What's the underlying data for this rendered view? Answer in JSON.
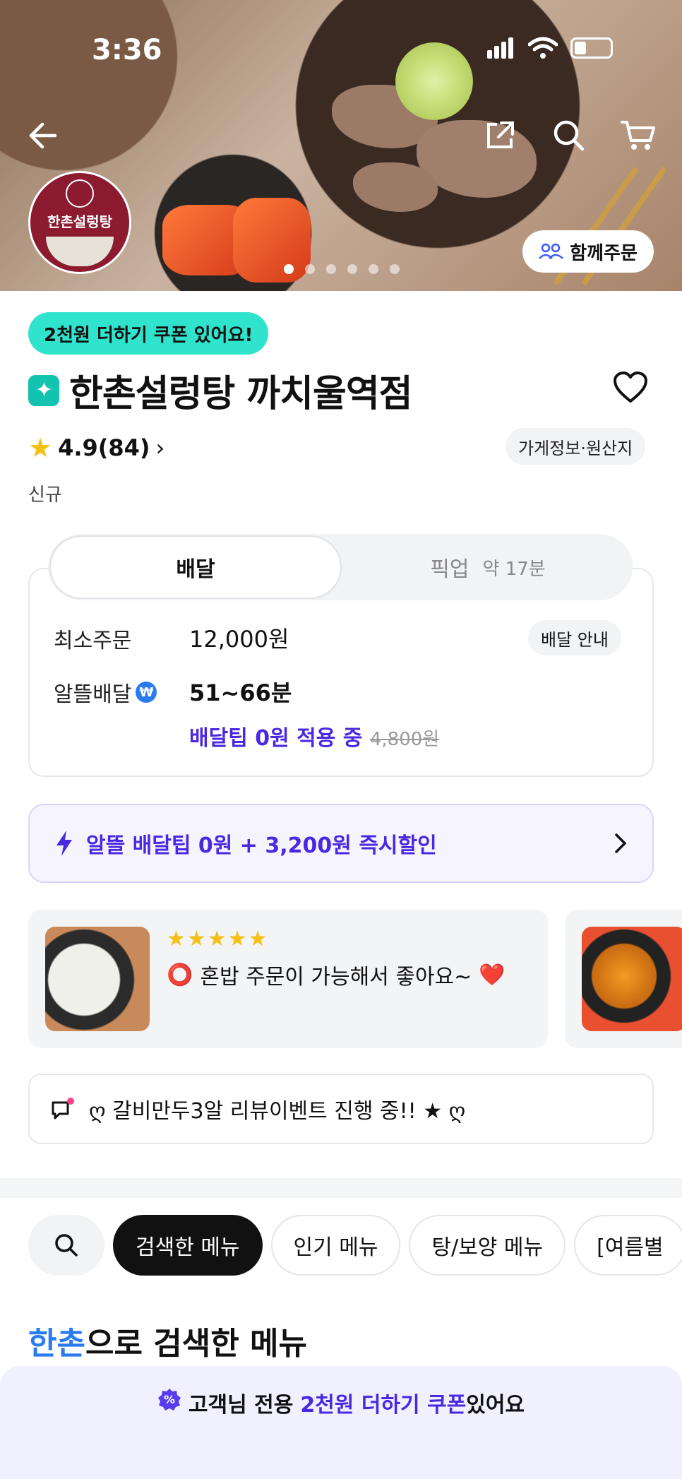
{
  "status_bar": {
    "time": "3:36"
  },
  "hero": {
    "logo_text": "한촌설렁탕",
    "together_label": "함께주문",
    "dots": 6,
    "active_dot": 1
  },
  "coupon_pill": "2천원 더하기 쿠폰 있어요!",
  "store": {
    "name": "한촌설렁탕 까치울역점",
    "rating": "4.9(84)",
    "info_label": "가게정보·원산지",
    "tag": "신규"
  },
  "tabs": {
    "delivery": "배달",
    "pickup": "픽업",
    "pickup_time": "약 17분"
  },
  "delivery": {
    "min_order_label": "최소주문",
    "min_order_value": "12,000원",
    "guide_label": "배달 안내",
    "saver_label": "알뜰배달",
    "saver_time": "51~66분",
    "tip_applied": "배달팁 0원 적용 중",
    "tip_original": "4,800원"
  },
  "promo": {
    "text": "알뜰 배달팁 0원 + 3,200원 즉시할인"
  },
  "review": {
    "stars": "★★★★★",
    "circle": "⭕",
    "text": "혼밥 주문이 가능해서 좋아요~",
    "heart": "❤️"
  },
  "notice": {
    "text": "ღ 갈비만두3알 리뷰이벤트 진행 중!! ★ ღ"
  },
  "menu_tabs": [
    "검색한 메뉴",
    "인기 메뉴",
    "탕/보양 메뉴",
    "[여름별"
  ],
  "section": {
    "highlight": "한촌",
    "rest": "으로 검색한 메뉴"
  },
  "bottom_banner": {
    "prefix": "고객님 전용",
    "highlight": "2천원 더하기 쿠폰",
    "suffix": "있어요"
  },
  "colors": {
    "accent": "#4a27e0",
    "mint": "#2fe3cc",
    "star": "#f5c013",
    "blue": "#2b7bf0"
  }
}
